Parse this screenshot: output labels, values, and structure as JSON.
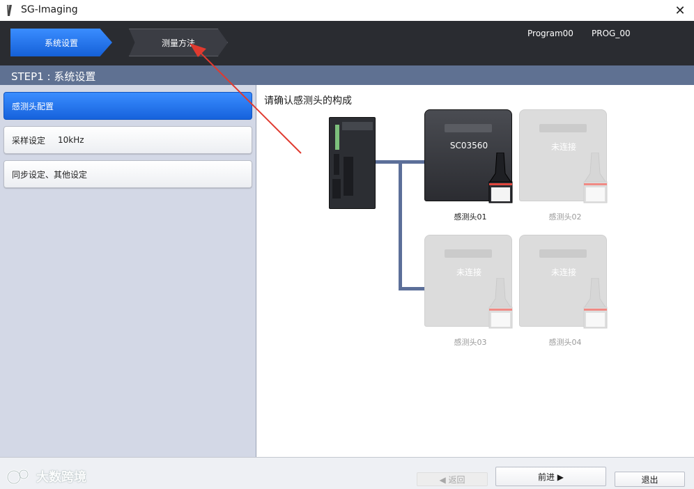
{
  "window": {
    "title": "SG-Imaging",
    "close_glyph": "✕"
  },
  "header": {
    "tabs": [
      {
        "label": "系统设置"
      },
      {
        "label": "测量方法"
      }
    ],
    "program": "Program00",
    "prog_id": "PROG_00"
  },
  "stepbar": {
    "title": "STEP1 : 系统设置"
  },
  "sidebar": {
    "items": [
      {
        "label": "感测头配置",
        "value": ""
      },
      {
        "label": "采样设定",
        "value": "10kHz"
      },
      {
        "label": "同步设定、其他设定",
        "value": ""
      }
    ]
  },
  "main": {
    "heading": "请确认感测头的构成",
    "heads": [
      {
        "status_text": "SC03560",
        "caption": "感测头01",
        "connected": true
      },
      {
        "status_text": "未连接",
        "caption": "感测头02",
        "connected": false
      },
      {
        "status_text": "未连接",
        "caption": "感测头03",
        "connected": false
      },
      {
        "status_text": "未连接",
        "caption": "感测头04",
        "connected": false
      }
    ]
  },
  "footer": {
    "back_label": "◀ 返回",
    "next_label": "前进 ▶",
    "exit_label": "退出",
    "watermark": "大数跨境"
  },
  "colors": {
    "accent": "#1d6ee8",
    "header_bg": "#2a2c31",
    "stepbar_bg": "#5f7192",
    "wire": "#5c6f99",
    "annotation_arrow": "#e03a2f"
  },
  "icons": [
    "app-icon",
    "close-icon",
    "controller-icon",
    "sensor-head-icon",
    "watermark-logo-icon"
  ]
}
